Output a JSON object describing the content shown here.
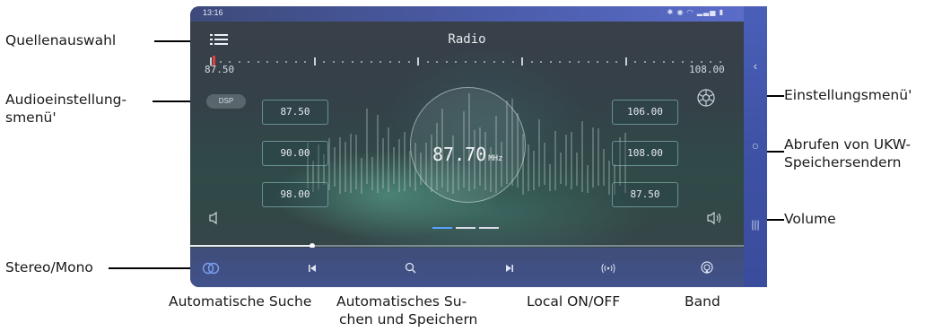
{
  "status_bar": {
    "time": "13:16"
  },
  "header": {
    "title": "Radio"
  },
  "scale": {
    "min_label": "87.50",
    "max_label": "108.00",
    "current_marker_mhz": 87.5
  },
  "display": {
    "frequency": "87.70",
    "unit": "MHz"
  },
  "presets_left": [
    "87.50",
    "90.00",
    "98.00"
  ],
  "presets_right": [
    "106.00",
    "108.00",
    "87.50"
  ],
  "dsp_label": "DSP",
  "progress_fraction": 0.22,
  "page_indicator": {
    "count": 3,
    "active": 0
  },
  "annotations": {
    "source": "Quellenauswahl",
    "audio_line1": "Audioeinstellung-",
    "audio_line2": "smenü'",
    "settings": "Einstellungsmenü'",
    "recall_line1": "Abrufen von UKW-",
    "recall_line2": "Speichersendern",
    "volume": "Volume",
    "stereo": "Stereo/Mono",
    "autosearch": "Automatische Suche",
    "autostore_line1": "Automatisches  Su-",
    "autostore_line2": "chen und Speichern",
    "local": "Local ON/OFF",
    "band": "Band"
  },
  "colors": {
    "accent_blue": "#4b5caa",
    "marker_red": "#e04040",
    "stereo_icon": "#7aa0f0"
  }
}
